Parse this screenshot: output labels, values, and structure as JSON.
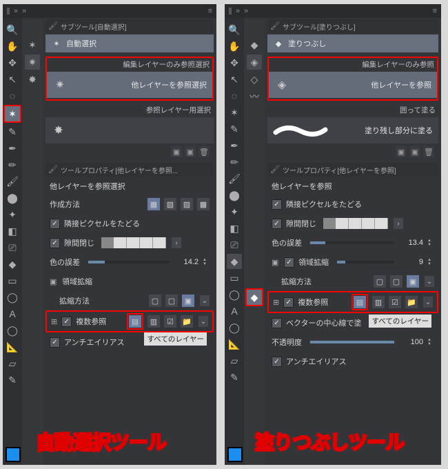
{
  "left": {
    "subtool_header": "サブツール[自動選択]",
    "strow": "自動選択",
    "group1_label": "編集レイヤーのみ参照選択",
    "group1_item": "他レイヤーを参照選択",
    "group2_label": "参照レイヤー用選択",
    "prop_header": "ツールプロパティ[他レイヤーを参照...",
    "prop_title": "他レイヤーを参照選択",
    "make_method": "作成方法",
    "adj_px": "隣接ピクセルをたどる",
    "gap_close": "隙間閉じ",
    "color_diff": "色の誤差",
    "color_diff_v": "14.2",
    "area_exp": "領域拡縮",
    "exp_method": "拡縮方法",
    "multi_ref": "複数参照",
    "antialias": "アンチエイリアス",
    "dropdown": "すべてのレイヤー",
    "big": "自動選択ツール"
  },
  "right": {
    "subtool_header": "サブツール[塗りつぶし]",
    "strow": "塗りつぶし",
    "group1_label": "編集レイヤーのみ参照",
    "group1_item": "他レイヤーを参照",
    "group2_label": "囲って塗る",
    "group2_item": "塗り残し部分に塗る",
    "prop_header": "ツールプロパティ[他レイヤーを参照]",
    "prop_title": "他レイヤーを参照",
    "adj_px": "隣接ピクセルをたどる",
    "gap_close": "隙間閉じ",
    "color_diff": "色の誤差",
    "color_diff_v": "13.4",
    "area_exp": "領域拡縮",
    "area_exp_v": "9",
    "exp_method": "拡縮方法",
    "multi_ref": "複数参照",
    "vector_center": "ベクターの中心線で塗",
    "opacity": "不透明度",
    "opacity_v": "100",
    "antialias": "アンチエイリアス",
    "dropdown": "すべてのレイヤー",
    "big": "塗りつぶしツール"
  }
}
